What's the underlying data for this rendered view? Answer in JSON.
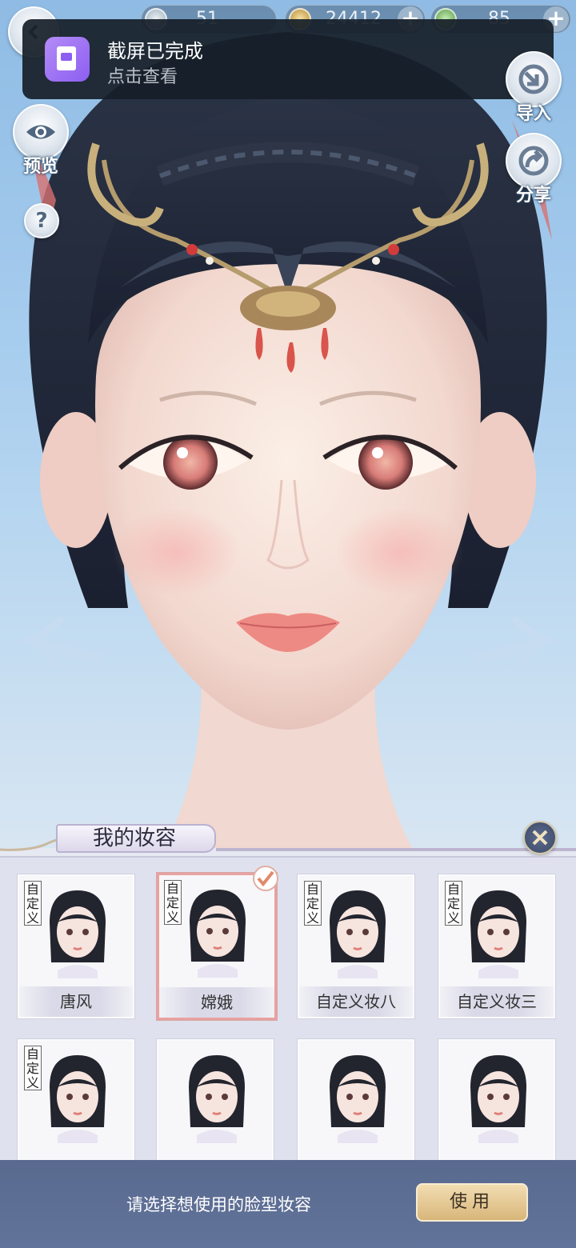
{
  "currency": [
    {
      "icon": "silver-coin-icon",
      "value": "51"
    },
    {
      "icon": "gold-coin-icon",
      "value": "24412"
    },
    {
      "icon": "jade-icon",
      "value": "85"
    }
  ],
  "notification": {
    "title": "截屏已完成",
    "subtitle": "点击查看",
    "icon": "screenshot-icon"
  },
  "side_buttons": {
    "preview": "预览",
    "help": "?",
    "import": "导入",
    "share": "分享"
  },
  "panel": {
    "title": "我的妆容",
    "close_icon": "close-icon"
  },
  "cards": [
    {
      "tag": "自定义",
      "name": "唐风",
      "selected": false
    },
    {
      "tag": "自定义",
      "name": "嫦娥",
      "selected": true
    },
    {
      "tag": "自定义",
      "name": "自定义妆八",
      "selected": false
    },
    {
      "tag": "自定义",
      "name": "自定义妆三",
      "selected": false
    },
    {
      "tag": "自定义",
      "name": "",
      "selected": false
    },
    {
      "tag": "",
      "name": "",
      "selected": false
    },
    {
      "tag": "",
      "name": "",
      "selected": false
    },
    {
      "tag": "",
      "name": "",
      "selected": false
    }
  ],
  "footer": {
    "hint": "请选择想使用的脸型妆容",
    "use_label": "使用"
  },
  "colors": {
    "accent": "#d8b67a",
    "footer": "#5f7096",
    "selected_border": "#e7a2a0"
  }
}
